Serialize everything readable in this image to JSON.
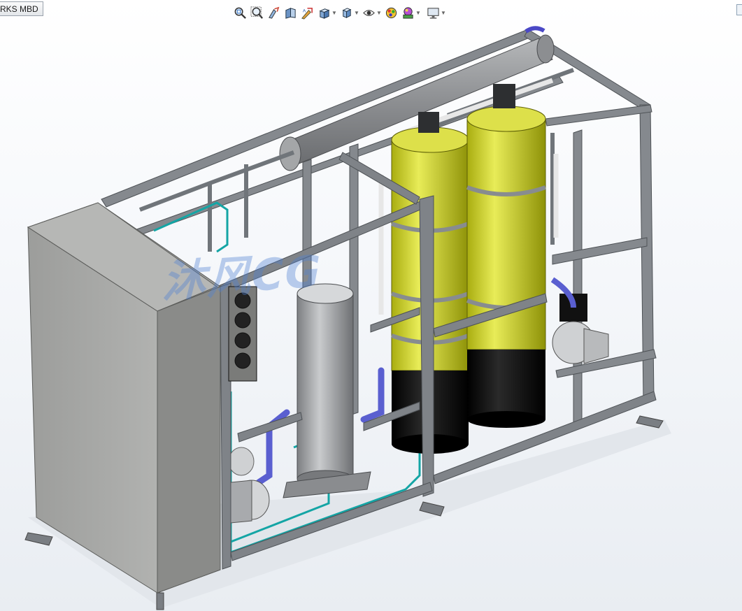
{
  "tab": {
    "label": "RKS MBD"
  },
  "heads_up_toolbar": {
    "tools": [
      {
        "name": "zoom-to-fit",
        "icon": "zoom-fit-icon"
      },
      {
        "name": "zoom-to-area",
        "icon": "zoom-area-icon"
      },
      {
        "name": "previous-view",
        "icon": "previous-view-icon"
      },
      {
        "name": "section-view",
        "icon": "section-view-icon"
      },
      {
        "name": "dynamic-annotation-views",
        "icon": "annotation-view-icon"
      },
      {
        "name": "view-orientation",
        "icon": "view-orientation-icon"
      },
      {
        "name": "display-style",
        "icon": "display-style-icon"
      },
      {
        "name": "hide-show-items",
        "icon": "eye-icon"
      },
      {
        "name": "edit-appearance",
        "icon": "appearance-icon"
      },
      {
        "name": "apply-scene",
        "icon": "scene-icon"
      },
      {
        "name": "view-settings",
        "icon": "monitor-icon"
      }
    ]
  },
  "watermark": {
    "text": "沐风CG"
  },
  "colors": {
    "frame": "#7d8186",
    "panel": "#a9aaa8",
    "tank_yellow": "#c8cc1e",
    "tank_black": "#0a0a0a",
    "pipe_teal": "#14a5a5",
    "hose_blue": "#5a5fd0"
  }
}
